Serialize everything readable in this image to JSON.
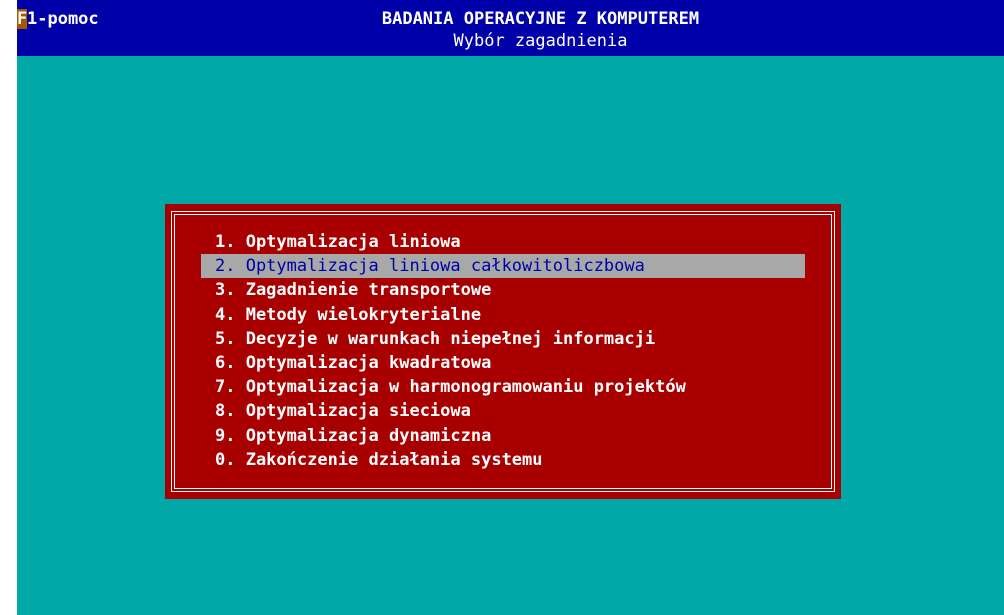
{
  "header": {
    "help_hotkey": "F",
    "help_rest": "1-pomoc",
    "title": "BADANIA OPERACYJNE Z KOMPUTEREM",
    "subtitle": "Wybór zagadnienia"
  },
  "menu": {
    "selected_index": 1,
    "items": [
      {
        "label": "1. Optymalizacja liniowa"
      },
      {
        "label": "2. Optymalizacja liniowa całkowitoliczbowa"
      },
      {
        "label": "3. Zagadnienie transportowe"
      },
      {
        "label": "4. Metody wielokryterialne"
      },
      {
        "label": "5. Decyzje w warunkach niepełnej informacji"
      },
      {
        "label": "6. Optymalizacja kwadratowa"
      },
      {
        "label": "7. Optymalizacja w harmonogramowaniu projektów"
      },
      {
        "label": "8. Optymalizacja sieciowa"
      },
      {
        "label": "9. Optymalizacja dynamiczna"
      },
      {
        "label": "0. Zakończenie działania systemu"
      }
    ]
  },
  "colors": {
    "background": "#00a8a8",
    "title_bar": "#0000a8",
    "menu_box": "#a80000",
    "selection": "#a8a8a8",
    "selected_text": "#0000a8",
    "hotkey_highlight": "#a85400"
  }
}
